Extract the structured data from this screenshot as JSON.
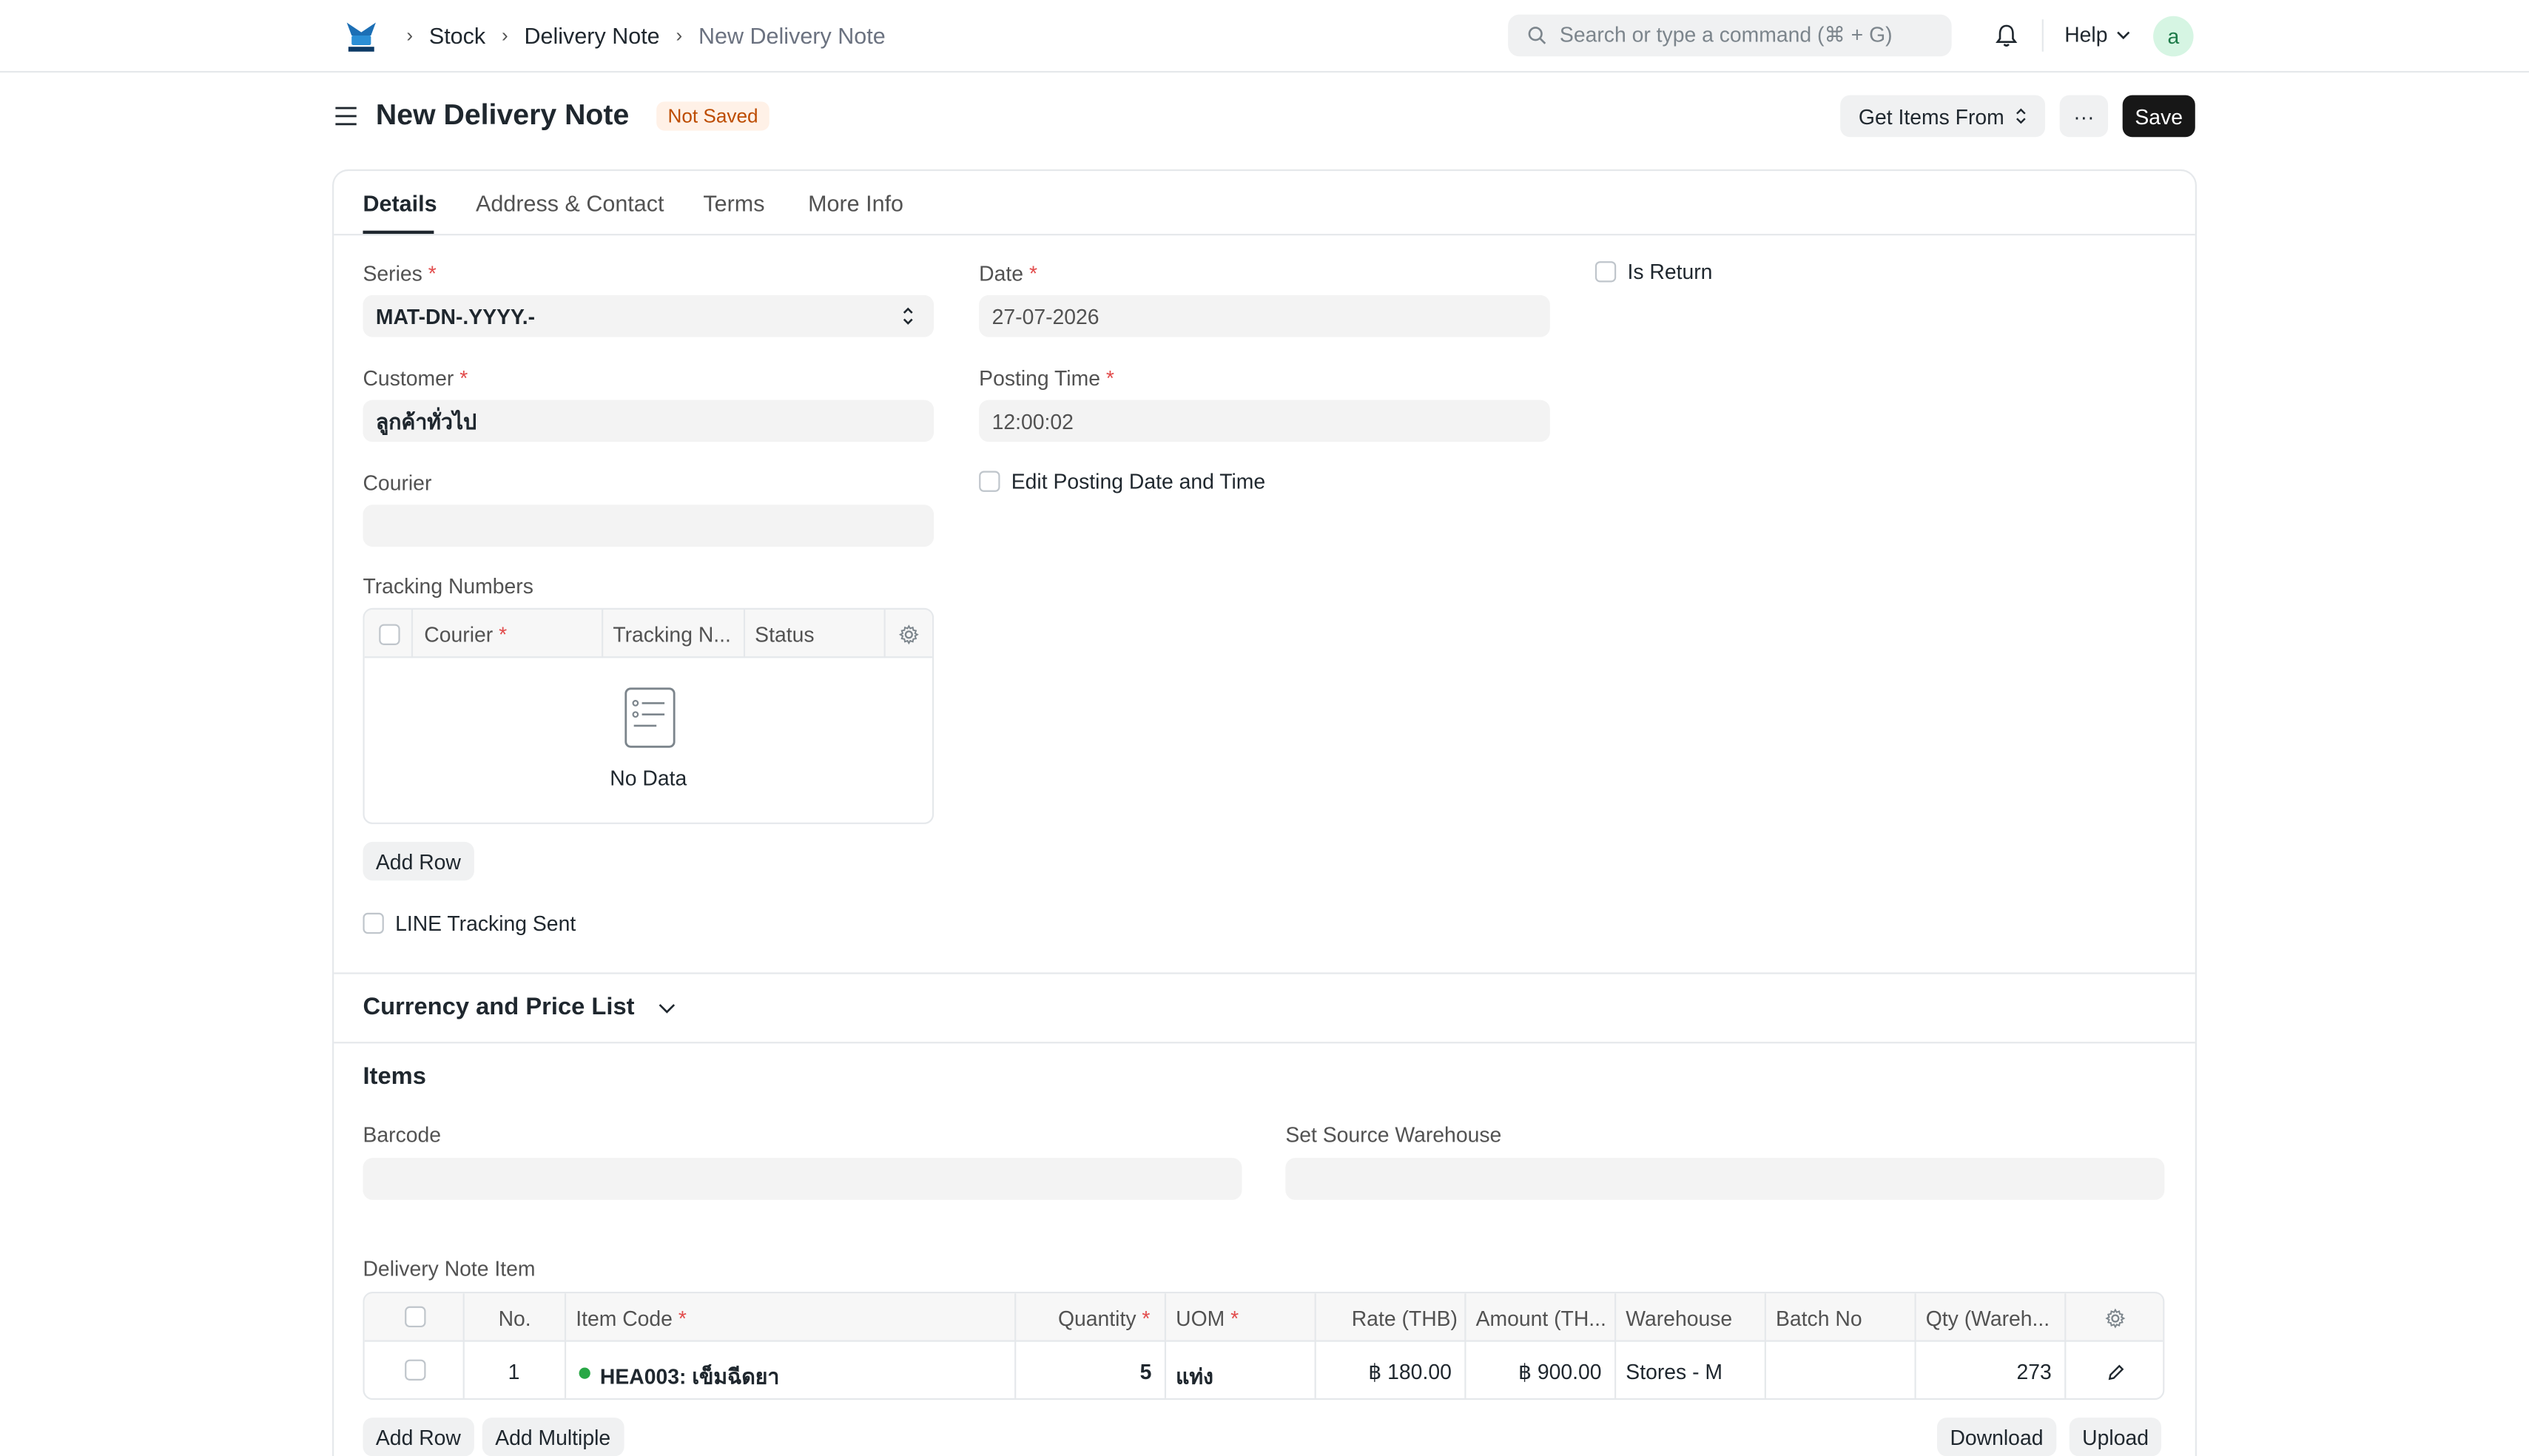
{
  "navbar": {
    "breadcrumbs": [
      "Stock",
      "Delivery Note",
      "New Delivery Note"
    ],
    "search_placeholder": "Search or type a command (⌘ + G)",
    "help_label": "Help",
    "avatar_letter": "a"
  },
  "page": {
    "title": "New Delivery Note",
    "status_badge": "Not Saved",
    "get_items_label": "Get Items From",
    "more_label": "···",
    "save_label": "Save"
  },
  "tabs": [
    {
      "label": "Details",
      "active": true
    },
    {
      "label": "Address & Contact",
      "active": false
    },
    {
      "label": "Terms",
      "active": false
    },
    {
      "label": "More Info",
      "active": false
    }
  ],
  "details": {
    "series_label": "Series",
    "series_value": "MAT-DN-.YYYY.-",
    "date_label": "Date",
    "date_value": "27-07-2026",
    "is_return_label": "Is Return",
    "customer_label": "Customer",
    "customer_value": "ลูกค้าทั่วไป",
    "posting_time_label": "Posting Time",
    "posting_time_value": "12:00:02",
    "edit_posting_label": "Edit Posting Date and Time",
    "courier_label": "Courier",
    "courier_value": "",
    "tracking_label": "Tracking Numbers",
    "tracking_columns": [
      "Courier",
      "Tracking N...",
      "Status"
    ],
    "no_data": "No Data",
    "add_row_label": "Add Row",
    "line_tracking_label": "LINE Tracking Sent"
  },
  "currency_section": {
    "title": "Currency and Price List"
  },
  "items_section": {
    "title": "Items",
    "barcode_label": "Barcode",
    "source_wh_label": "Set Source Warehouse",
    "table_label": "Delivery Note Item",
    "columns": {
      "no": "No.",
      "item_code": "Item Code",
      "quantity": "Quantity",
      "uom": "UOM",
      "rate": "Rate (THB)",
      "amount": "Amount (TH...",
      "warehouse": "Warehouse",
      "batch": "Batch No",
      "qty_wh": "Qty (Wareh..."
    },
    "rows": [
      {
        "no": "1",
        "item_code": "HEA003: เข็มฉีดยา",
        "quantity": "5",
        "uom": "แท่ง",
        "rate": "฿ 180.00",
        "amount": "฿ 900.00",
        "warehouse": "Stores - M",
        "batch": "",
        "qty_wh": "273"
      }
    ],
    "add_row_label": "Add Row",
    "add_multiple_label": "Add Multiple",
    "download_label": "Download",
    "upload_label": "Upload"
  },
  "colors": {
    "accent_dark": "#171717",
    "badge_bg": "#fff1e7",
    "badge_text": "#bd4c00",
    "status_dot": "#28a745"
  }
}
